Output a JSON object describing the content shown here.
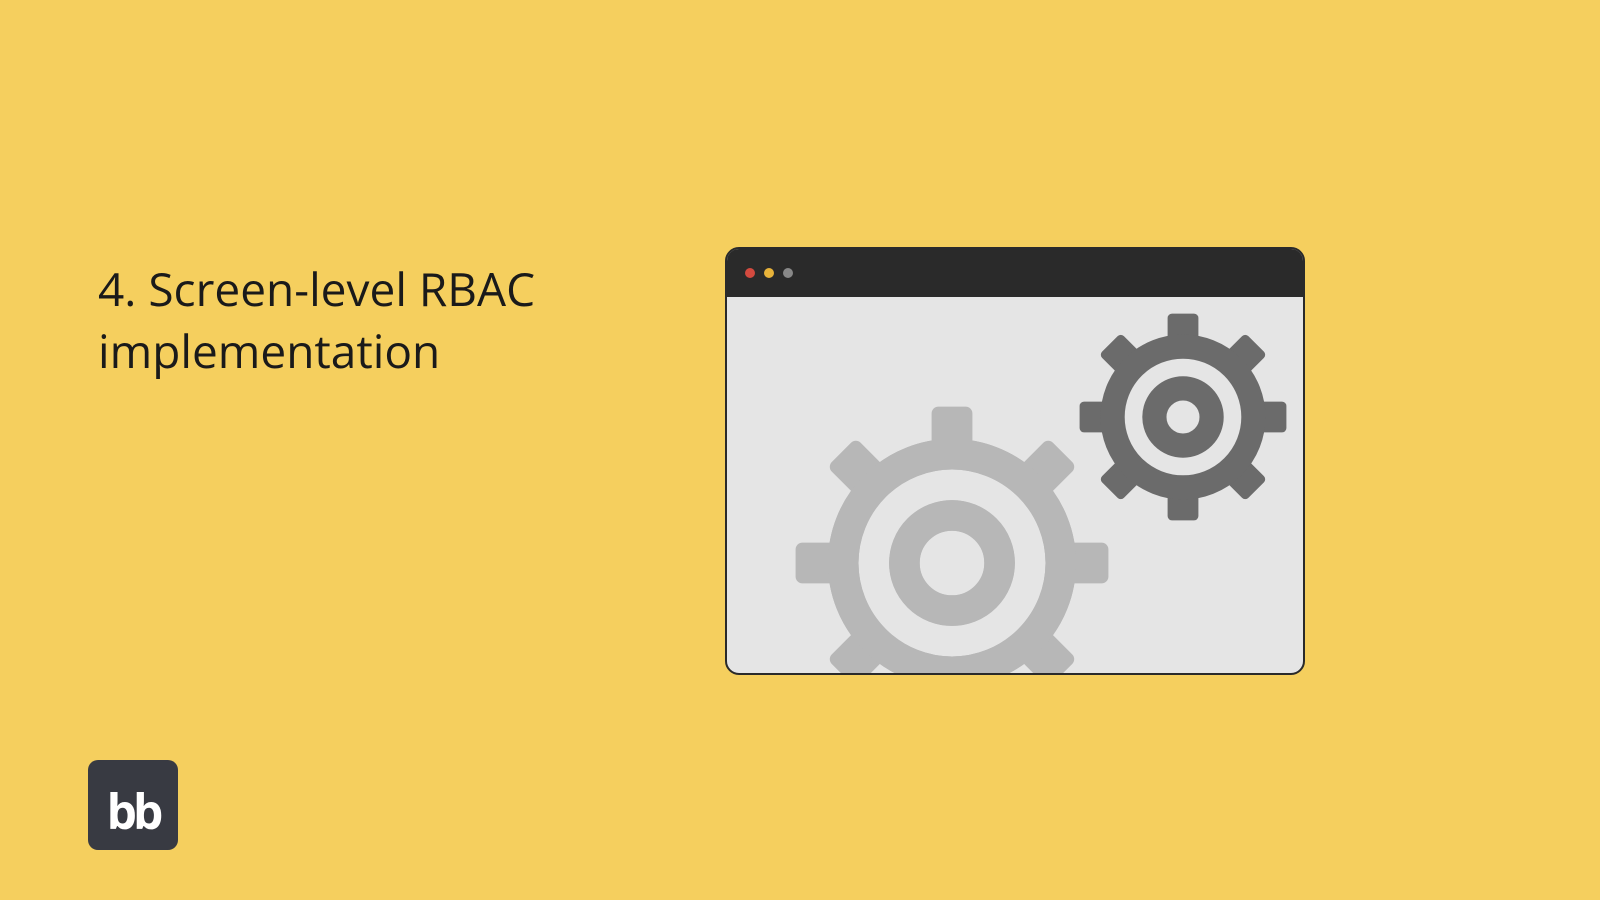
{
  "heading": "4. Screen-level RBAC implementation",
  "logo": "bb",
  "colors": {
    "background": "#f5cf5e",
    "logoBox": "#383a42",
    "windowChrome": "#2a2a2a",
    "windowBody": "#e5e5e5",
    "dotRed": "#d34a3f",
    "dotYellow": "#e8b33a",
    "dotGray": "#888888",
    "gearLight": "#b7b7b7",
    "gearDark": "#6b6b6b"
  }
}
